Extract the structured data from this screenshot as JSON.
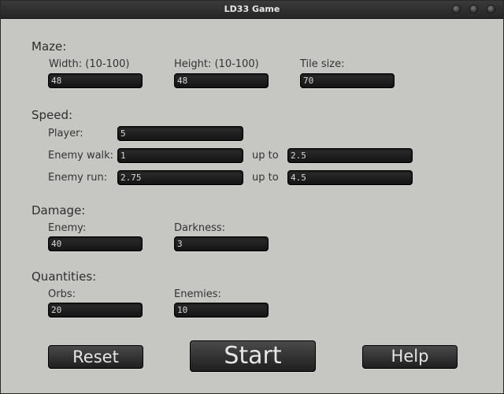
{
  "window": {
    "title": "LD33 Game"
  },
  "maze": {
    "heading": "Maze:",
    "width_label": "Width: (10-100)",
    "width_value": "48",
    "height_label": "Height: (10-100)",
    "height_value": "48",
    "tile_label": "Tile size:",
    "tile_value": "70"
  },
  "speed": {
    "heading": "Speed:",
    "player_label": "Player:",
    "player_value": "5",
    "enemy_walk_label": "Enemy walk:",
    "enemy_walk_min": "1",
    "enemy_walk_upto": "up to",
    "enemy_walk_max": "2.5",
    "enemy_run_label": "Enemy run:",
    "enemy_run_min": "2.75",
    "enemy_run_upto": "up to",
    "enemy_run_max": "4.5"
  },
  "damage": {
    "heading": "Damage:",
    "enemy_label": "Enemy:",
    "enemy_value": "40",
    "darkness_label": "Darkness:",
    "darkness_value": "3"
  },
  "quantities": {
    "heading": "Quantities:",
    "orbs_label": "Orbs:",
    "orbs_value": "20",
    "enemies_label": "Enemies:",
    "enemies_value": "10"
  },
  "buttons": {
    "reset": "Reset",
    "start": "Start",
    "help": "Help"
  }
}
